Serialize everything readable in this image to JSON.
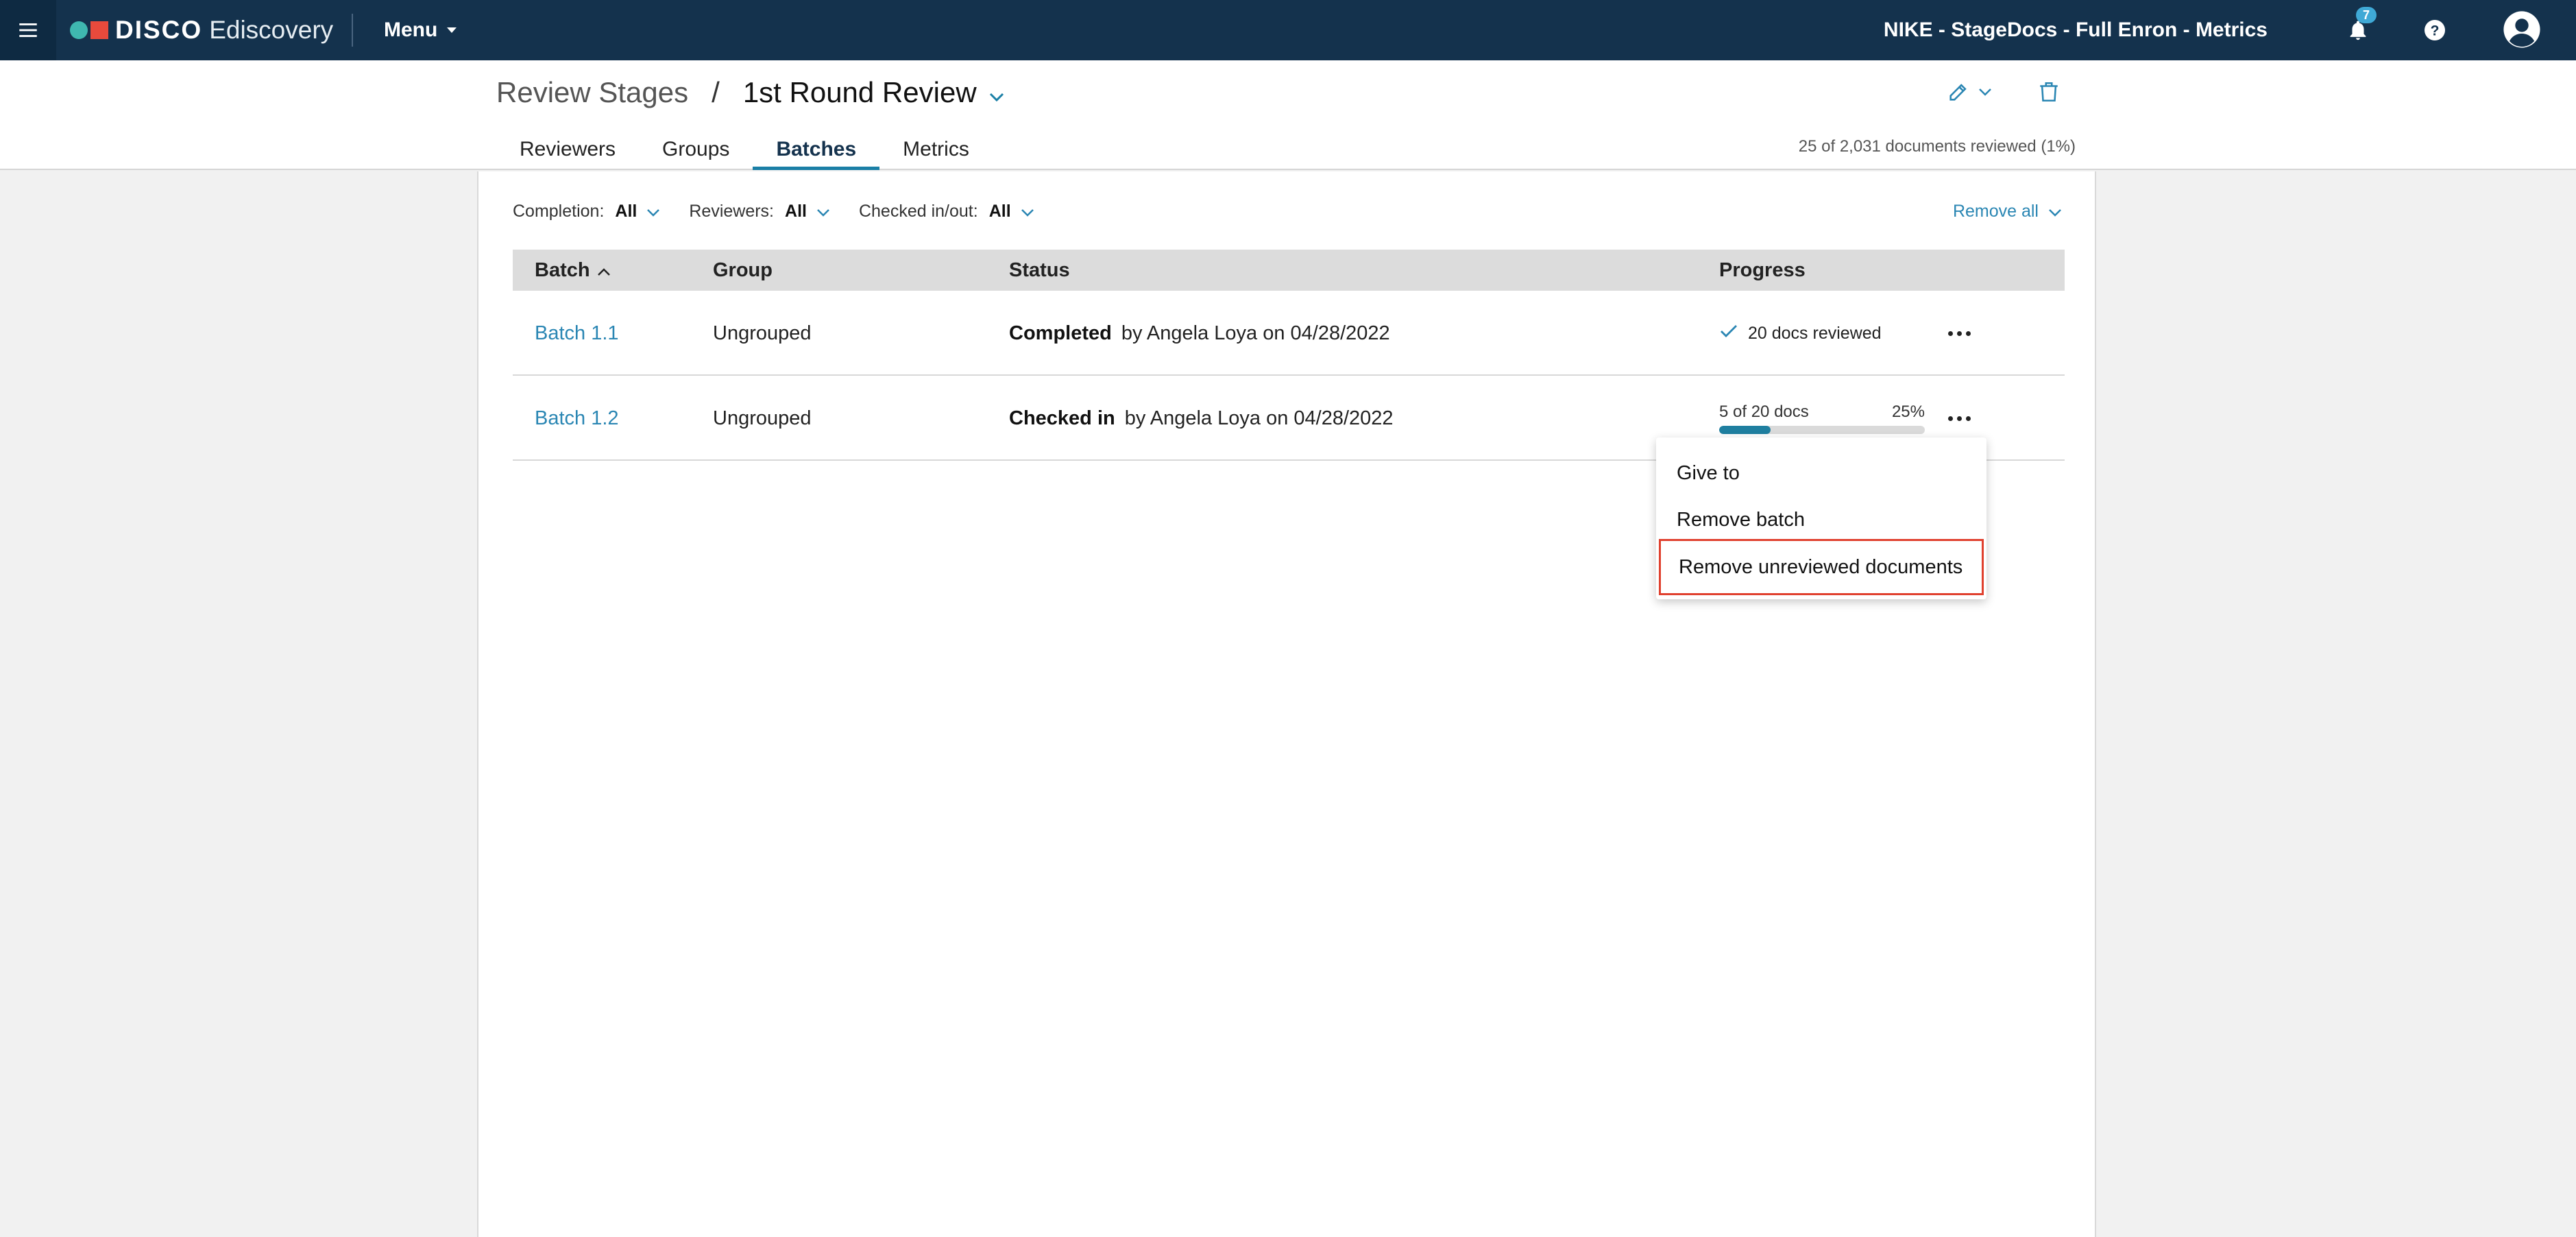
{
  "topbar": {
    "menu_icon": "hamburger-menu-icon",
    "logo_text": "DISCO",
    "product_name": "Ediscovery",
    "menu_label": "Menu",
    "project_title": "NIKE - StageDocs - Full Enron - Metrics",
    "notification_count": "7",
    "icons": [
      "bell-icon",
      "help-icon",
      "user-avatar-icon"
    ]
  },
  "header": {
    "breadcrumb_parent": "Review Stages",
    "breadcrumb_separator": "/",
    "breadcrumb_current": "1st Round Review",
    "tabs": [
      {
        "label": "Reviewers"
      },
      {
        "label": "Groups"
      },
      {
        "label": "Batches",
        "active": true
      },
      {
        "label": "Metrics"
      }
    ],
    "reviewed_summary": "25 of 2,031 documents reviewed (1%)"
  },
  "filters": {
    "completion_label": "Completion:",
    "completion_value": "All",
    "reviewers_label": "Reviewers:",
    "reviewers_value": "All",
    "checked_label": "Checked in/out:",
    "checked_value": "All",
    "remove_all": "Remove all"
  },
  "table": {
    "headers": {
      "batch": "Batch",
      "group": "Group",
      "status": "Status",
      "progress": "Progress"
    },
    "rows": [
      {
        "batch": "Batch 1.1",
        "group": "Ungrouped",
        "status_bold": "Completed",
        "status_rest": "by Angela Loya on 04/28/2022",
        "progress_text": "20 docs reviewed"
      },
      {
        "batch": "Batch 1.2",
        "group": "Ungrouped",
        "status_bold": "Checked in",
        "status_rest": "by Angela Loya on 04/28/2022",
        "progress_count": "5 of 20 docs",
        "progress_percent": "25%",
        "progress_fraction": 0.25
      }
    ]
  },
  "dropdown": {
    "items": [
      "Give to",
      "Remove batch",
      "Remove unreviewed documents"
    ],
    "highlight_color": "#e0412f"
  },
  "colors": {
    "topbar_bg": "#14324d",
    "link": "#2a86b3",
    "accent": "#1a7fa6"
  }
}
